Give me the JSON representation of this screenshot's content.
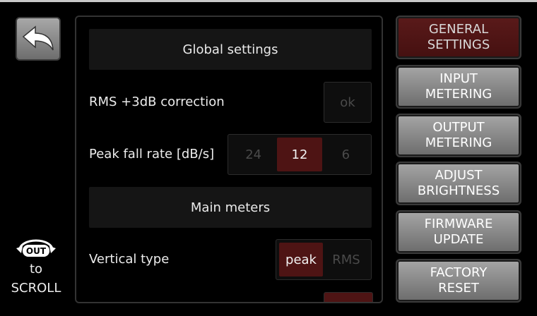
{
  "scroll_hint": {
    "knob_label": "OUT",
    "line1": "to",
    "line2": "SCROLL"
  },
  "global_settings": {
    "title": "Global settings",
    "rms_label": "RMS +3dB correction",
    "rms_button": "ok",
    "peak_label": "Peak fall rate [dB/s]",
    "peak_options": [
      "24",
      "12",
      "6"
    ],
    "peak_selected": "12"
  },
  "main_meters": {
    "title": "Main meters",
    "vertical_label": "Vertical type",
    "vertical_options": [
      "peak",
      "RMS"
    ],
    "vertical_selected": "peak"
  },
  "menu": [
    {
      "line1": "GENERAL",
      "line2": "SETTINGS",
      "active": true
    },
    {
      "line1": "INPUT",
      "line2": "METERING",
      "active": false
    },
    {
      "line1": "OUTPUT",
      "line2": "METERING",
      "active": false
    },
    {
      "line1": "ADJUST",
      "line2": "BRIGHTNESS",
      "active": false
    },
    {
      "line1": "FIRMWARE",
      "line2": "UPDATE",
      "active": false
    },
    {
      "line1": "FACTORY",
      "line2": "RESET",
      "active": false
    }
  ],
  "colors": {
    "active_fill": "#4e1414",
    "panel_bg": "#151515",
    "button_gray": "#8a8a8a"
  },
  "icons": {
    "back": "back-arrow-icon",
    "knob": "rotary-knob-icon"
  }
}
